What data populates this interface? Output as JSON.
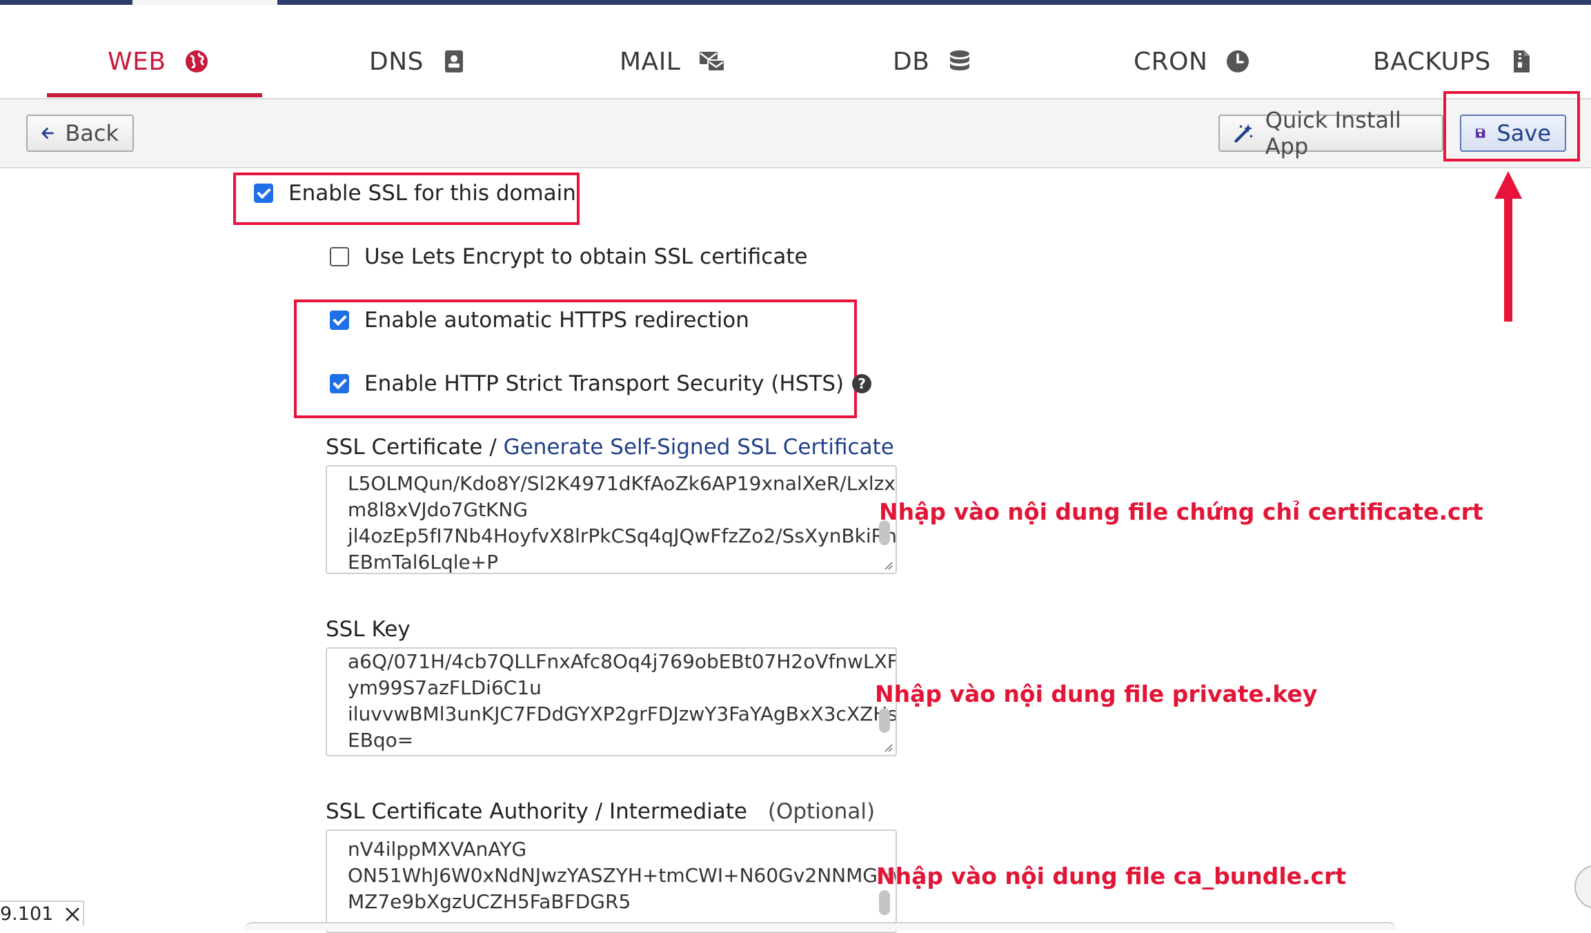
{
  "tabs": [
    {
      "label": "WEB",
      "icon": "globe-icon",
      "active": true
    },
    {
      "label": "DNS",
      "icon": "address-book-icon",
      "active": false
    },
    {
      "label": "MAIL",
      "icon": "mail-icon",
      "active": false
    },
    {
      "label": "DB",
      "icon": "database-icon",
      "active": false
    },
    {
      "label": "CRON",
      "icon": "clock-icon",
      "active": false
    },
    {
      "label": "BACKUPS",
      "icon": "archive-file-icon",
      "active": false
    }
  ],
  "toolbar": {
    "back_label": "Back",
    "quick_install_label": "Quick Install App",
    "save_label": "Save"
  },
  "ssl": {
    "enable_ssl": {
      "label": "Enable SSL for this domain",
      "checked": true
    },
    "lets_encrypt": {
      "label": "Use Lets Encrypt to obtain SSL certificate",
      "checked": false
    },
    "https_redirect": {
      "label": "Enable automatic HTTPS redirection",
      "checked": true
    },
    "hsts": {
      "label": "Enable HTTP Strict Transport Security (HSTS)",
      "checked": true
    },
    "cert_label": "SSL Certificate /",
    "cert_link": "Generate Self-Signed SSL Certificate",
    "cert_value": "L5OLMQun/Kdo8Y/Sl2K4971dKfAoZk6AP19xnalXeR/LxlzxM\nm8l8xVJdo7GtKNG\njl4ozEp5fI7Nb4HoyfvX8lrPkCSq4qJQwFfzZo2/SsXynBkiRnj\nEBmTal6Lqle+P",
    "key_label": "SSL Key",
    "key_value": "a6Q/071H/4cb7QLLFnxAfc8Oq4j769obEBt07H2oVfnwLXFS\nym99S7azFLDi6C1u\niluvvwBMl3unKJC7FDdGYXP2grFDJzwY3FaYAgBxX3cXZHs\nEBqo=",
    "ca_label": "SSL Certificate Authority / Intermediate",
    "ca_optional": "(Optional)",
    "ca_value": "nV4ilppMXVAnAYG\nON51WhJ6W0xNdNJwzYASZYH+tmCWI+N60Gv2NNMGHw\nMZ7e9bXgzUCZH5FaBFDGR5"
  },
  "annotations": {
    "cert_note": "Nhập vào nội dung file chứng chỉ certificate.crt",
    "key_note": "Nhập vào nội dung file private.key",
    "ca_note": "Nhập vào nội dung file ca_bundle.crt"
  },
  "corner_text": "9.101",
  "colors": {
    "accent": "#c71a3c",
    "annotation": "#e8123a",
    "checkbox": "#1f6fe6",
    "link": "#1f3f8a"
  }
}
